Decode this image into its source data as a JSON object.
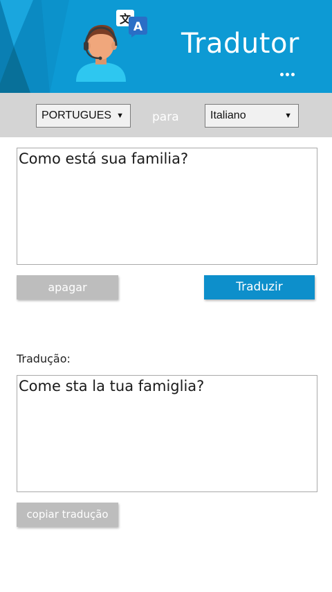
{
  "header": {
    "title": "Tradutor",
    "background_color": "#0d9ad4",
    "icons": [
      "support-agent-icon",
      "translate-icon"
    ]
  },
  "language_bar": {
    "from_language": "PORTUGUES",
    "separator": "para",
    "to_language": "Italiano",
    "background_color": "#d4d4d4"
  },
  "source": {
    "text": "Como está sua familia?"
  },
  "actions": {
    "clear_label": "apagar",
    "translate_label": "Traduzir",
    "translate_color": "#0d8fcb"
  },
  "result": {
    "label": "Tradução:",
    "text": "Come sta la tua famiglia?",
    "copy_label": "copiar tradução"
  }
}
